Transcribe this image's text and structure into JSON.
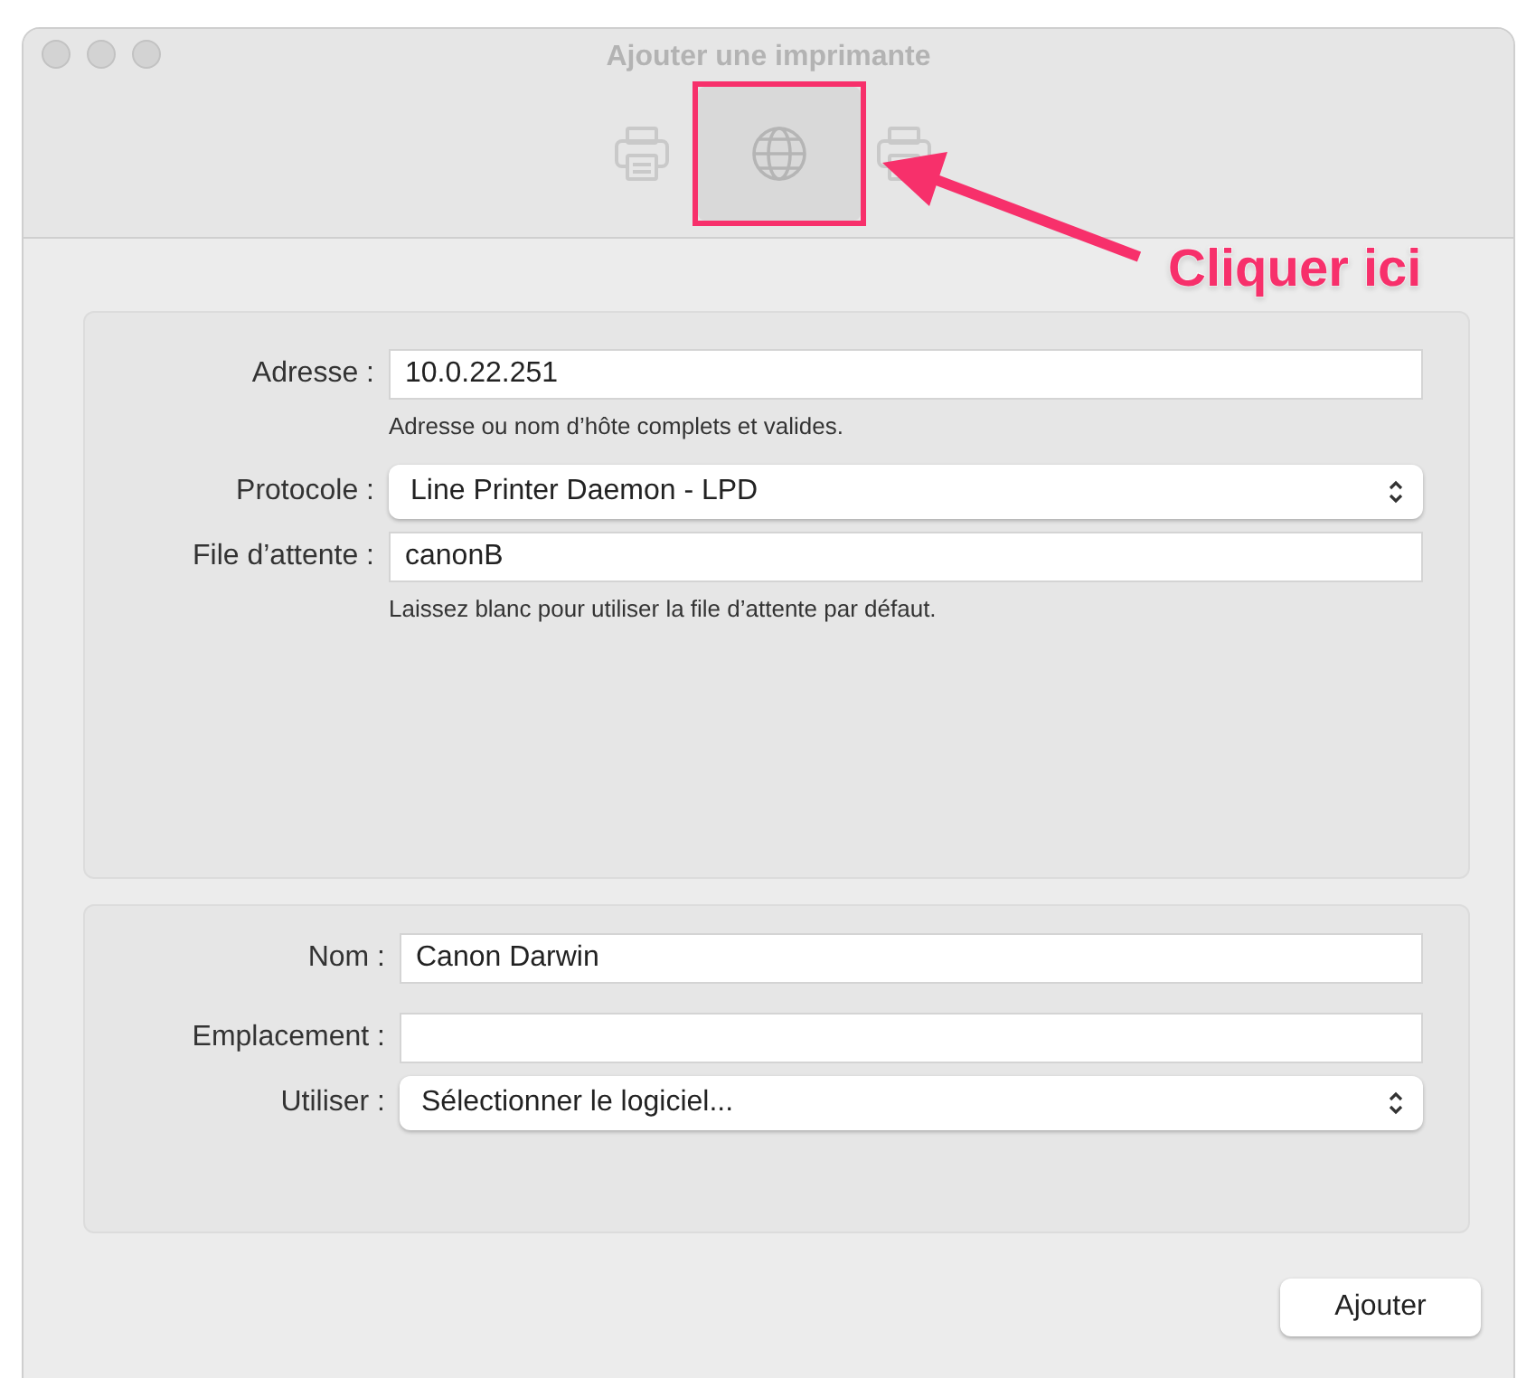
{
  "window": {
    "title": "Ajouter une imprimante"
  },
  "toolbar": [
    {
      "kind": "printer",
      "selected": false
    },
    {
      "kind": "globe",
      "selected": true
    },
    {
      "kind": "printer",
      "selected": false
    }
  ],
  "annotation": {
    "label": "Cliquer ici"
  },
  "connection_panel": {
    "rows": [
      {
        "kind": "text",
        "label": "Adresse :",
        "value": "10.0.22.251",
        "hint": "Adresse ou nom d’hôte complets et valides."
      },
      {
        "kind": "popup",
        "label": "Protocole :",
        "value": "Line Printer Daemon - LPD"
      },
      {
        "kind": "text",
        "label": "File d’attente :",
        "value": "canonB",
        "hint": "Laissez blanc pour utiliser la file d’attente par défaut."
      }
    ]
  },
  "printer_panel": {
    "rows": [
      {
        "kind": "text",
        "label": "Nom :",
        "value": "Canon Darwin"
      },
      {
        "kind": "text",
        "label": "Emplacement :"
      },
      {
        "kind": "popup",
        "label": "Utiliser :",
        "value": "Sélectionner le logiciel..."
      }
    ]
  },
  "buttons": [
    "Ajouter"
  ]
}
